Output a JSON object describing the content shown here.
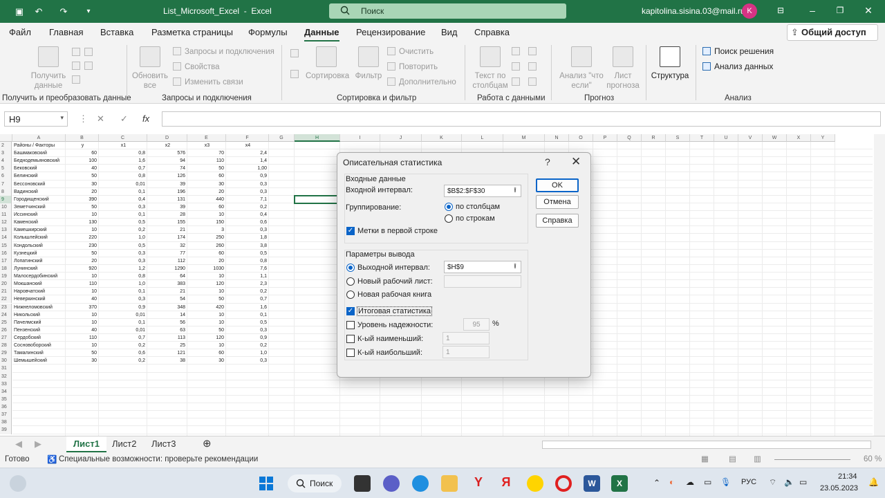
{
  "titlebar": {
    "filename": "List_Microsoft_Excel",
    "app": "Excel",
    "search_placeholder": "Поиск",
    "user_email": "kapitolina.sisina.03@mail.ru",
    "avatar_letter": "K"
  },
  "menu": {
    "items": [
      "Файл",
      "Главная",
      "Вставка",
      "Разметка страницы",
      "Формулы",
      "Данные",
      "Рецензирование",
      "Вид",
      "Справка"
    ],
    "active": "Данные",
    "share": "Общий доступ"
  },
  "ribbon": {
    "get_data": "Получить данные",
    "refresh_all": "Обновить все",
    "queries_connections": "Запросы и подключения",
    "properties": "Свойства",
    "edit_links": "Изменить связи",
    "sort": "Сортировка",
    "filter": "Фильтр",
    "clear": "Очистить",
    "reapply": "Повторить",
    "advanced": "Дополнительно",
    "text_to_columns": "Текст по столбцам",
    "what_if": "Анализ \"что если\"",
    "forecast_sheet": "Лист прогноза",
    "outline": "Структура",
    "solver": "Поиск решения",
    "data_analysis": "Анализ данных",
    "groups": [
      "Получить и преобразовать данные",
      "Запросы и подключения",
      "Сортировка и фильтр",
      "Работа с данными",
      "Прогноз",
      "Анализ"
    ]
  },
  "formula_bar": {
    "name_box": "H9",
    "fx": "fx",
    "value": ""
  },
  "sheet": {
    "columns": [
      "A",
      "B",
      "C",
      "D",
      "E",
      "F",
      "G",
      "H",
      "I",
      "J",
      "K",
      "L",
      "M",
      "N",
      "O",
      "P",
      "Q",
      "R",
      "S",
      "T",
      "U",
      "V",
      "W",
      "X",
      "Y"
    ],
    "header_row": [
      "Районы / Факторы",
      "y",
      "x1",
      "x2",
      "x3",
      "x4"
    ],
    "rows": [
      [
        "Башмаковский",
        "60",
        "0,8",
        "576",
        "70",
        "2,4"
      ],
      [
        "Беднодемьяновский",
        "100",
        "1,6",
        "94",
        "110",
        "1,4"
      ],
      [
        "Бековский",
        "40",
        "0,7",
        "74",
        "50",
        "1,00"
      ],
      [
        "Белинский",
        "50",
        "0,8",
        "126",
        "60",
        "0,9"
      ],
      [
        "Бессоновский",
        "30",
        "0,01",
        "39",
        "30",
        "0,3"
      ],
      [
        "Вадинский",
        "20",
        "0,1",
        "196",
        "20",
        "0,3"
      ],
      [
        "Городищенский",
        "390",
        "0,4",
        "131",
        "440",
        "7,1"
      ],
      [
        "Земетчинский",
        "50",
        "0,3",
        "39",
        "60",
        "0,2"
      ],
      [
        "Иссинский",
        "10",
        "0,1",
        "28",
        "10",
        "0,4"
      ],
      [
        "Каменский",
        "130",
        "0,5",
        "155",
        "150",
        "0,6"
      ],
      [
        "Камешкирский",
        "10",
        "0,2",
        "21",
        "3",
        "0,3"
      ],
      [
        "Колышлейский",
        "220",
        "1,0",
        "174",
        "250",
        "1,8"
      ],
      [
        "Кондольский",
        "230",
        "0,5",
        "32",
        "260",
        "3,8"
      ],
      [
        "Кузнецкий",
        "50",
        "0,3",
        "77",
        "60",
        "0,5"
      ],
      [
        "Лопатинский",
        "20",
        "0,3",
        "112",
        "20",
        "0,8"
      ],
      [
        "Лунинский",
        "920",
        "1,2",
        "1290",
        "1030",
        "7,6"
      ],
      [
        "Малосердобинский",
        "10",
        "0,8",
        "64",
        "10",
        "1,1"
      ],
      [
        "Мокшанский",
        "110",
        "1,0",
        "383",
        "120",
        "2,3"
      ],
      [
        "Наровчатский",
        "10",
        "0,1",
        "21",
        "10",
        "0,2"
      ],
      [
        "Неверкинский",
        "40",
        "0,3",
        "54",
        "50",
        "0,7"
      ],
      [
        "Нижнеломовский",
        "370",
        "0,9",
        "348",
        "420",
        "1,6"
      ],
      [
        "Никольский",
        "10",
        "0,01",
        "14",
        "10",
        "0,1"
      ],
      [
        "Пачелмский",
        "10",
        "0,1",
        "56",
        "10",
        "0,5"
      ],
      [
        "Пензенский",
        "40",
        "0,01",
        "63",
        "50",
        "0,3"
      ],
      [
        "Сердобский",
        "110",
        "0,7",
        "113",
        "120",
        "0,9"
      ],
      [
        "Сосновоборский",
        "10",
        "0,2",
        "25",
        "10",
        "0,2"
      ],
      [
        "Тамалинский",
        "50",
        "0,6",
        "121",
        "60",
        "1,0"
      ],
      [
        "Шемышейский",
        "30",
        "0,2",
        "38",
        "30",
        "0,3"
      ]
    ],
    "row_numbers": [
      "2",
      "3",
      "4",
      "5",
      "6",
      "7",
      "8",
      "9",
      "10",
      "11",
      "12",
      "13",
      "14",
      "15",
      "16",
      "17",
      "18",
      "19",
      "20",
      "21",
      "22",
      "23",
      "24",
      "25",
      "26",
      "27",
      "28",
      "29",
      "30",
      "31",
      "32",
      "33",
      "34",
      "35",
      "36",
      "37",
      "38",
      "39"
    ]
  },
  "tabs": {
    "sheets": [
      "Лист1",
      "Лист2",
      "Лист3"
    ],
    "active": "Лист1"
  },
  "status": {
    "ready": "Готово",
    "accessibility": "Специальные возможности: проверьте рекомендации",
    "zoom": "60 %"
  },
  "dialog": {
    "title": "Описательная статистика",
    "help": "?",
    "input_section": "Входные данные",
    "input_range_label": "Входной интервал:",
    "input_range_value": "$B$2:$F$30",
    "grouping_label": "Группирование:",
    "by_columns": "по столбцам",
    "by_rows": "по строкам",
    "labels_first_row": "Метки в первой строке",
    "output_section": "Параметры вывода",
    "output_range_label": "Выходной интервал:",
    "output_range_value": "$H$9",
    "new_sheet": "Новый рабочий лист:",
    "new_workbook": "Новая рабочая книга",
    "summary_stats": "Итоговая статистика",
    "confidence_level": "Уровень надежности:",
    "confidence_value": "95",
    "percent": "%",
    "kth_smallest": "К-ый наименьший:",
    "kth_smallest_value": "1",
    "kth_largest": "К-ый наибольший:",
    "kth_largest_value": "1",
    "ok": "OK",
    "cancel": "Отмена",
    "help_btn": "Справка"
  },
  "taskbar": {
    "search": "Поиск",
    "lang": "РУС",
    "time": "21:34",
    "date": "23.05.2023"
  },
  "colors": {
    "excel_green": "#217346",
    "accent_blue": "#0a64c8"
  }
}
